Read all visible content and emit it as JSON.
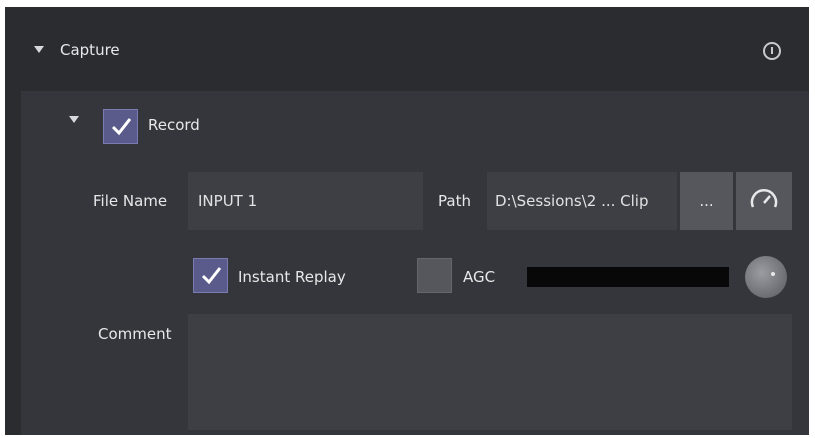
{
  "capture": {
    "title": "Capture",
    "record": {
      "label": "Record",
      "checked": true,
      "file_name_label": "File Name",
      "file_name_value": "INPUT 1",
      "path_label": "Path",
      "path_value": "D:\\Sessions\\2 ... Clip",
      "browse_label": "...",
      "instant_replay_label": "Instant Replay",
      "instant_replay_checked": true,
      "agc_label": "AGC",
      "agc_checked": false,
      "comment_label": "Comment",
      "comment_value": ""
    }
  },
  "colors": {
    "accent": "#5a5b8a",
    "panel_bg": "#2b2c30",
    "body_bg": "#35363b",
    "field_bg": "#3e3f44"
  },
  "icons": {
    "section_toggle": "caret-down-icon",
    "info": "info-icon",
    "speed": "gauge-icon",
    "check": "checkmark-icon"
  }
}
